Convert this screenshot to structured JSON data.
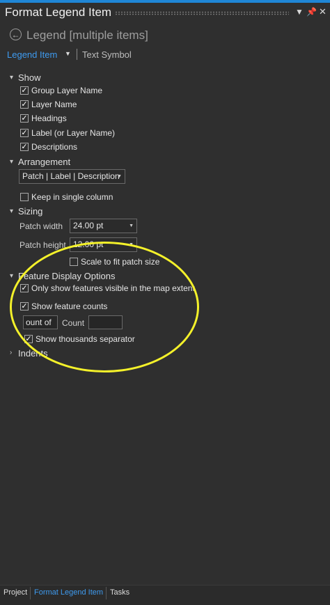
{
  "window": {
    "title": "Format Legend Item"
  },
  "header": {
    "back_title": "Legend [multiple items]"
  },
  "tabs": {
    "active": "Legend Item",
    "other": "Text Symbol"
  },
  "show": {
    "title": "Show",
    "items": [
      {
        "label": "Group Layer Name",
        "checked": true
      },
      {
        "label": "Layer Name",
        "checked": true
      },
      {
        "label": "Headings",
        "checked": true
      },
      {
        "label": "Label (or Layer Name)",
        "checked": true
      },
      {
        "label": "Descriptions",
        "checked": true
      }
    ]
  },
  "arrangement": {
    "title": "Arrangement",
    "value": "Patch | Label | Description",
    "keep_single_column": {
      "label": "Keep in single column",
      "checked": false
    }
  },
  "sizing": {
    "title": "Sizing",
    "patch_width_label": "Patch width",
    "patch_width_value": "24.00 pt",
    "patch_height_label": "Patch height",
    "patch_height_value": "12.00 pt",
    "scale_label": "Scale to fit patch size",
    "scale_checked": false
  },
  "feature_display": {
    "title": "Feature Display Options",
    "only_visible": {
      "label": "Only show features visible in the map extent",
      "checked": true
    },
    "show_counts": {
      "label": "Show feature counts",
      "checked": true
    },
    "count_field_value": "ount of",
    "count_label": "Count",
    "count_value": "",
    "thousands": {
      "label": "Show thousands separator",
      "checked": true
    }
  },
  "indents": {
    "title": "Indents"
  },
  "bottom_tabs": [
    "Project",
    "Format Legend Item",
    "Tasks"
  ],
  "colors": {
    "accent": "#3e9bf0",
    "highlight": "#f4f12a",
    "background": "#2f2f2f"
  }
}
